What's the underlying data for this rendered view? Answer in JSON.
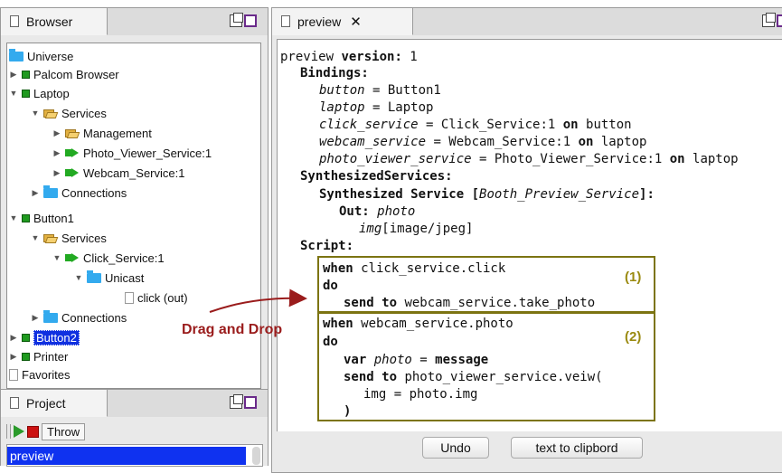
{
  "browser": {
    "title": "Browser",
    "tree": [
      {
        "label": "Universe",
        "icon": "folder-icon"
      },
      {
        "label": "Palcom Browser",
        "icon": "node-icon"
      },
      {
        "label": "Laptop",
        "icon": "node-icon"
      },
      {
        "label": "Services",
        "icon": "open-folder-icon"
      },
      {
        "label": "Management",
        "icon": "open-folder-icon"
      },
      {
        "label": "Photo_Viewer_Service:1",
        "icon": "service-icon"
      },
      {
        "label": "Webcam_Service:1",
        "icon": "service-icon"
      },
      {
        "label": "Connections",
        "icon": "folder-icon"
      },
      {
        "label": "Button1",
        "icon": "node-icon"
      },
      {
        "label": "Services",
        "icon": "open-folder-icon"
      },
      {
        "label": "Click_Service:1",
        "icon": "service-icon"
      },
      {
        "label": "Unicast",
        "icon": "folder-icon"
      },
      {
        "label": "click (out)",
        "icon": "page-icon"
      },
      {
        "label": "Connections",
        "icon": "folder-icon"
      },
      {
        "label": "Button2",
        "icon": "node-icon"
      },
      {
        "label": "Printer",
        "icon": "node-icon"
      },
      {
        "label": "Favorites",
        "icon": "page-icon"
      }
    ]
  },
  "project": {
    "title": "Project",
    "throw_label": "Throw",
    "selected_item": "preview"
  },
  "editor": {
    "tab_title": "preview",
    "close_glyph": "✕",
    "code": {
      "l1a": "preview ",
      "l1b": "version:",
      "l1c": " 1",
      "bindings": "Bindings:",
      "b1a": "button",
      "b1b": " = Button1",
      "b2a": "laptop",
      "b2b": " = Laptop",
      "b3a": "click_service",
      "b3b": " = Click_Service:1 ",
      "b3c": "on",
      "b3d": " button",
      "b4a": "webcam_service",
      "b4b": " = Webcam_Service:1 ",
      "b4c": "on",
      "b4d": " laptop",
      "b5a": "photo_viewer_service",
      "b5b": " = Photo_Viewer_Service:1 ",
      "b5c": "on",
      "b5d": " laptop",
      "synth": "SynthesizedServices:",
      "s1a": "Synthesized Service [",
      "s1b": "Booth_Preview_Service",
      "s1c": "]:",
      "outa": "Out:",
      "outb": " photo",
      "imga": "img",
      "imgb": "[image/jpeg]",
      "script": "Script:",
      "w1a": "when",
      "w1b": " click_service.click",
      "do1": "do",
      "st1a": "send to",
      "st1b": " webcam_service.take_photo",
      "w2a": "when",
      "w2b": " webcam_service.photo",
      "do2": "do",
      "va": "var ",
      "vb": "photo",
      "vc": " = ",
      "vd": "message",
      "st2a": "send to",
      "st2b": " photo_viewer_service.veiw(",
      "imgarg": "img = photo.img",
      "close": ")"
    },
    "box1_label": "(1)",
    "box2_label": "(2)",
    "undo_label": "Undo",
    "clipboard_label": "text to clipbord"
  },
  "annotation": {
    "drag_drop": "Drag and Drop",
    "color": "#9a1c1c"
  }
}
